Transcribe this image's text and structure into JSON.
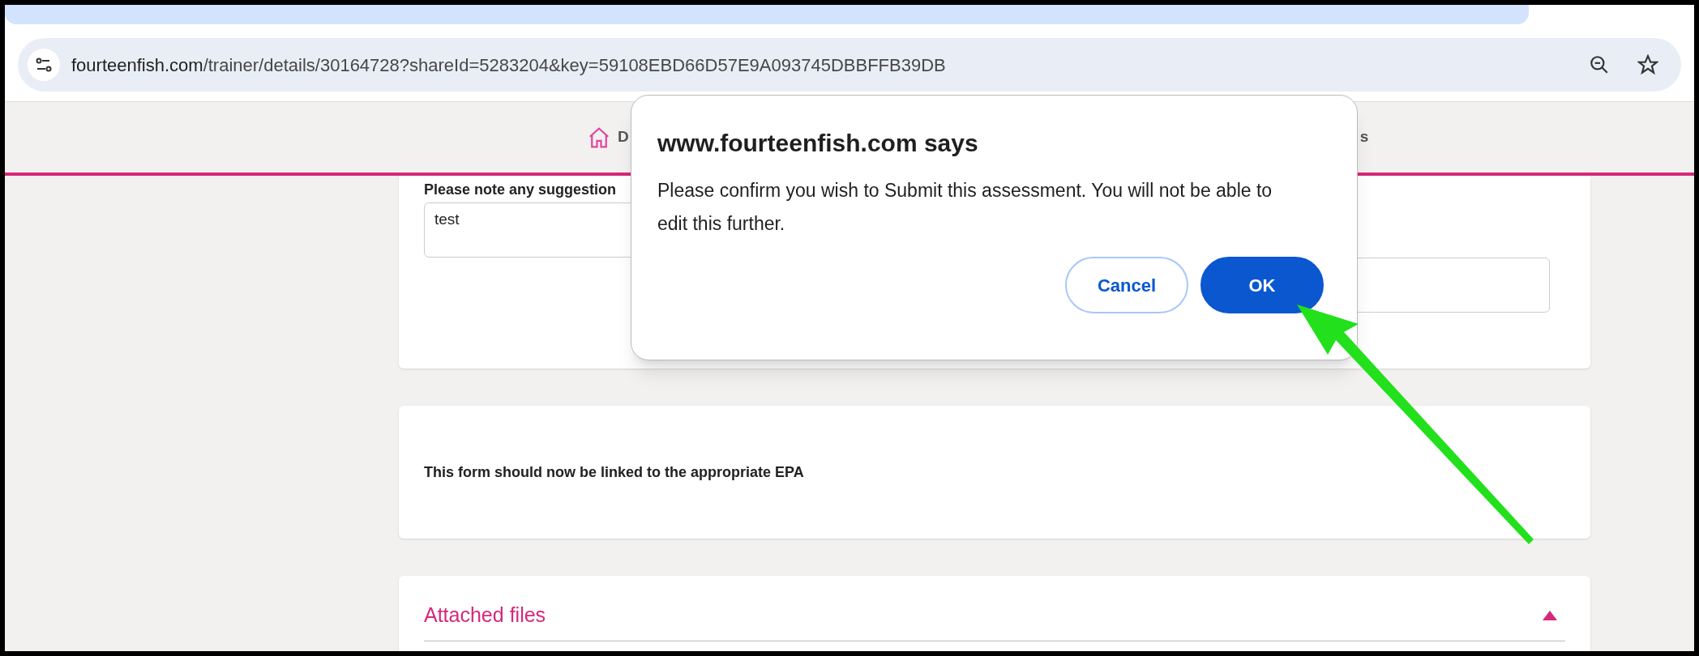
{
  "address_bar": {
    "host": "fourteenfish.com",
    "path": "/trainer/details/30164728?shareId=5283204&key=59108EBD66D57E9A093745DBBFFB39DB"
  },
  "nav": {
    "items": [
      {
        "label": "D",
        "kind": "home"
      },
      {
        "label": "s",
        "kind": "plain"
      }
    ]
  },
  "form_card": {
    "label": "Please note any suggestion",
    "value": "test"
  },
  "epa_card": {
    "text": "This form should now be linked to the appropriate EPA"
  },
  "files_card": {
    "title": "Attached files",
    "expanded": true
  },
  "dialog": {
    "title": "www.fourteenfish.com says",
    "message": "Please confirm you wish to Submit this assessment. You will not be able to edit this further.",
    "buttons": [
      {
        "label": "Cancel",
        "kind": "secondary"
      },
      {
        "label": "OK",
        "kind": "primary"
      }
    ]
  }
}
